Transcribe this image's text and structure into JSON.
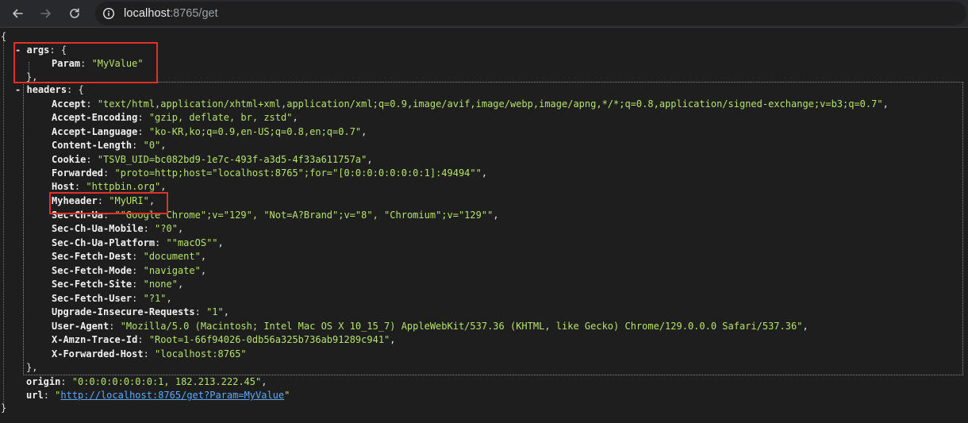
{
  "browser": {
    "back_icon": "arrow-left-icon",
    "forward_icon": "arrow-right-icon",
    "reload_icon": "reload-icon",
    "site_info_icon": "info-circle-icon",
    "url_host": "localhost",
    "url_rest": ":8765/get"
  },
  "json": {
    "open_brace": "{",
    "close_brace": "}",
    "args": {
      "collapse": "-",
      "key": "args",
      "open": ": {",
      "close": "},",
      "items": [
        {
          "key": "Param",
          "value": "\"MyValue\"",
          "trail": ""
        }
      ]
    },
    "headers": {
      "collapse": "-",
      "key": "headers",
      "open": ": {",
      "close": "},",
      "items": [
        {
          "key": "Accept",
          "value": "\"text/html,application/xhtml+xml,application/xml;q=0.9,image/avif,image/webp,image/apng,*/*;q=0.8,application/signed-exchange;v=b3;q=0.7\"",
          "trail": ","
        },
        {
          "key": "Accept-Encoding",
          "value": "\"gzip, deflate, br, zstd\"",
          "trail": ","
        },
        {
          "key": "Accept-Language",
          "value": "\"ko-KR,ko;q=0.9,en-US;q=0.8,en;q=0.7\"",
          "trail": ","
        },
        {
          "key": "Content-Length",
          "value": "\"0\"",
          "trail": ","
        },
        {
          "key": "Cookie",
          "value": "\"TSVB_UID=bc082bd9-1e7c-493f-a3d5-4f33a611757a\"",
          "trail": ","
        },
        {
          "key": "Forwarded",
          "value": "\"proto=http;host=\"localhost:8765\";for=\"[0:0:0:0:0:0:0:1]:49494\"\"",
          "trail": ","
        },
        {
          "key": "Host",
          "value": "\"httpbin.org\"",
          "trail": ","
        },
        {
          "key": "Myheader",
          "value": "\"MyURI\"",
          "trail": ","
        },
        {
          "key": "Sec-Ch-Ua",
          "value": "\"\"Google Chrome\";v=\"129\", \"Not=A?Brand\";v=\"8\", \"Chromium\";v=\"129\"\"",
          "trail": ","
        },
        {
          "key": "Sec-Ch-Ua-Mobile",
          "value": "\"?0\"",
          "trail": ","
        },
        {
          "key": "Sec-Ch-Ua-Platform",
          "value": "\"\"macOS\"\"",
          "trail": ","
        },
        {
          "key": "Sec-Fetch-Dest",
          "value": "\"document\"",
          "trail": ","
        },
        {
          "key": "Sec-Fetch-Mode",
          "value": "\"navigate\"",
          "trail": ","
        },
        {
          "key": "Sec-Fetch-Site",
          "value": "\"none\"",
          "trail": ","
        },
        {
          "key": "Sec-Fetch-User",
          "value": "\"?1\"",
          "trail": ","
        },
        {
          "key": "Upgrade-Insecure-Requests",
          "value": "\"1\"",
          "trail": ","
        },
        {
          "key": "User-Agent",
          "value": "\"Mozilla/5.0 (Macintosh; Intel Mac OS X 10_15_7) AppleWebKit/537.36 (KHTML, like Gecko) Chrome/129.0.0.0 Safari/537.36\"",
          "trail": ","
        },
        {
          "key": "X-Amzn-Trace-Id",
          "value": "\"Root=1-66f94026-0db56a325b736ab91289c941\"",
          "trail": ","
        },
        {
          "key": "X-Forwarded-Host",
          "value": "\"localhost:8765\"",
          "trail": ""
        }
      ]
    },
    "origin": {
      "key": "origin",
      "value": "\"0:0:0:0:0:0:0:1, 182.213.222.45\"",
      "trail": ","
    },
    "url": {
      "key": "url",
      "quote_open": "\"",
      "link": "http://localhost:8765/get?Param=MyValue",
      "quote_close": "\""
    },
    "colors": {
      "string": "#b5e26a",
      "link": "#5aa9ff",
      "highlight_box": "#e0302a"
    }
  }
}
